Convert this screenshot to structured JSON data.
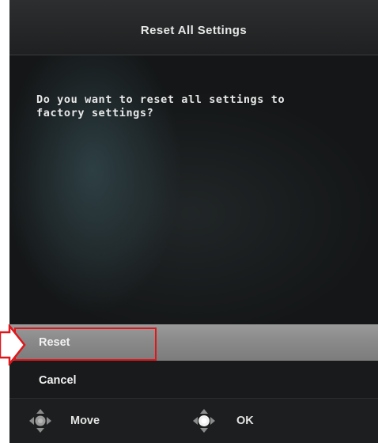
{
  "dialog": {
    "title": "Reset All Settings",
    "prompt_line1": "Do you want to reset all settings to",
    "prompt_line2": "factory settings?"
  },
  "menu": {
    "items": [
      {
        "label": "Reset",
        "selected": true
      },
      {
        "label": "Cancel",
        "selected": false
      }
    ]
  },
  "footer": {
    "move_label": "Move",
    "ok_label": "OK",
    "move_icon": "joystick-directions-icon",
    "ok_icon": "joystick-press-icon"
  },
  "annotation": {
    "highlight_color": "#e0161b"
  }
}
